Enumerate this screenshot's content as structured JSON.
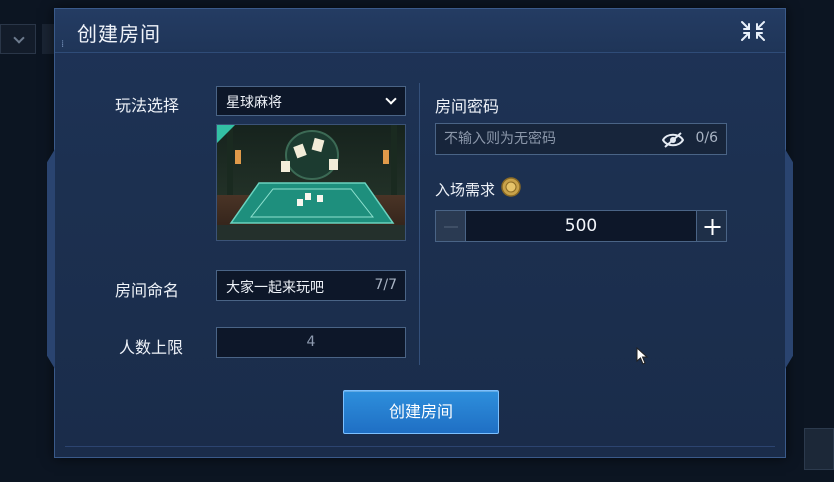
{
  "dialog": {
    "title": "创建房间",
    "close_icon": "collapse-icon"
  },
  "mode": {
    "label": "玩法选择",
    "selected": "星球麻将"
  },
  "room_name": {
    "label": "房间命名",
    "value": "大家一起来玩吧",
    "count": "7/7"
  },
  "player_limit": {
    "label": "人数上限",
    "value": "4"
  },
  "password": {
    "label": "房间密码",
    "placeholder": "不输入则为无密码",
    "count": "0/6"
  },
  "entry": {
    "label": "入场需求",
    "value": "500",
    "coin_icon": "gold-coin-icon"
  },
  "buttons": {
    "create": "创建房间"
  },
  "colors": {
    "accent": "#2e8fdc",
    "panel": "#1e3357",
    "field": "#0d1729",
    "preview_felt": "#1e8f7d"
  }
}
